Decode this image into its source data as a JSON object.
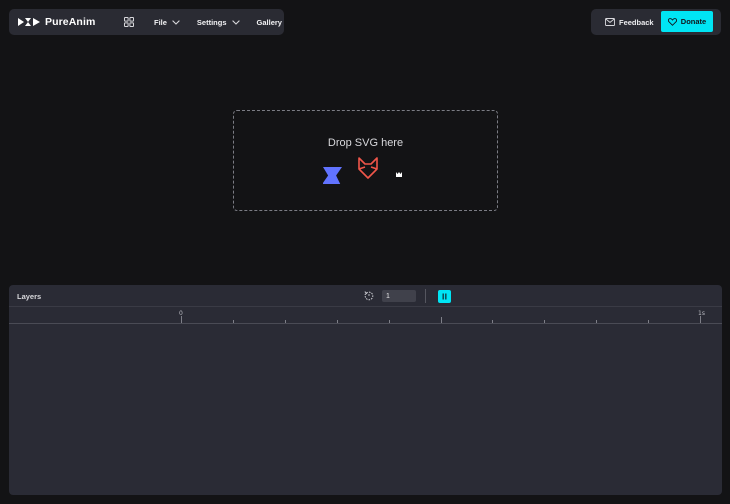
{
  "app": {
    "name": "PureAnim"
  },
  "menu": {
    "file_label": "File",
    "settings_label": "Settings",
    "gallery_label": "Gallery"
  },
  "actions": {
    "feedback_label": "Feedback",
    "donate_label": "Donate"
  },
  "dropzone": {
    "label": "Drop SVG here",
    "icons": [
      "star-shape-icon",
      "fox-outline-icon",
      "crown-icon"
    ]
  },
  "timeline": {
    "title": "Layers",
    "speed_value": "1",
    "ruler_labels": {
      "start": "0",
      "end": "1s"
    }
  },
  "colors": {
    "accent": "#00e5f4",
    "panel": "#2a2b33",
    "background": "#131315",
    "star_icon": "#6173ff",
    "fox_icon": "#f0564a"
  }
}
